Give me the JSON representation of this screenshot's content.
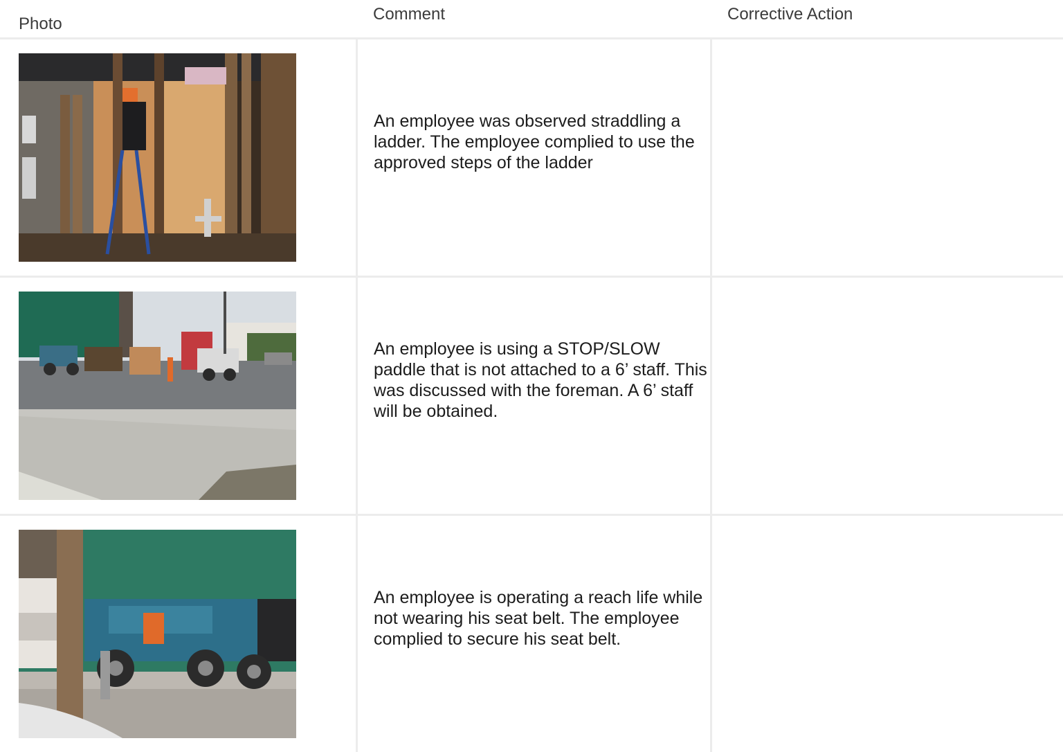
{
  "table": {
    "headers": {
      "photo": "Photo",
      "comment": "Comment",
      "corrective_action": "Corrective Action"
    },
    "rows": [
      {
        "comment": "An employee was observed straddling a ladder. The employee complied to use the approved steps of the ladder",
        "corrective_action": ""
      },
      {
        "comment": "An employee is using a STOP/SLOW paddle that is not attached to a 6’ staff. This was discussed with the foreman. A 6’ staff will be obtained.",
        "corrective_action": ""
      },
      {
        "comment": "An employee is operating a reach life while not wearing his seat belt. The employee complied to secure his seat belt.",
        "corrective_action": ""
      }
    ]
  },
  "colors": {
    "border": "#ececec",
    "header_text": "#3b3b3b",
    "body_text": "#1c1c1c"
  }
}
